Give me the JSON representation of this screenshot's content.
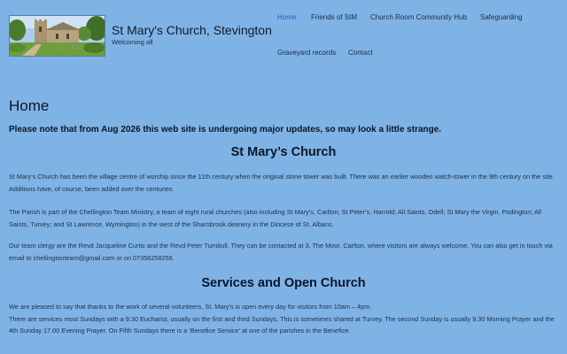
{
  "header": {
    "site_title": "St Mary's Church, Stevington",
    "tagline": "Welcoming all"
  },
  "nav": {
    "home": "Home",
    "friends": "Friends of StM",
    "hub": "Church Room Community Hub",
    "safeguarding": "Safeguarding",
    "graveyard": "Graveyard records",
    "contact": "Contact"
  },
  "main": {
    "page_heading": "Home",
    "notice": "Please note that from Aug 2026 this web site is undergoing major updates, so may look a little strange.",
    "section1_heading": "St Mary’s Church",
    "para1": "St Mary’s Church has been the village centre of worship since the 11th century when the original stone tower was built.  There was an earlier wooden watch-tower in the 9th century on the site.  Additions have, of course, been added over the centuries.",
    "para2": "The Parish is part of the Chellington Team Ministry, a team of eight rural churches (also including St Mary’s, Carlton; St Peter’s, Harrold; All Saints, Odell; St Mary the Virgin, Podington; All Saints, Turvey; and St Lawrence, Wymington) in the west of the Sharnbrook deanery in the Diocese of St. Albans.",
    "para3": "Our team clergy are the Revd Jacqueline Curtis and the Revd Peter Turnbull. They can be contacted at 3, The Moor, Carlton, where visitors are always welcome. You can also get in touch via email to chellingtonteam@gmail.com or on 07356258256.",
    "section2_heading": "Services and Open Church",
    "para4_line1": "We are pleased to say that thanks to the work of several volunteers, St. Mary’s is open every day for visitors from 10am – 4pm.",
    "para4_line2": "There are services most Sundays with a 9:30 Eucharist, usually on the first and third Sundays. This is sometimes shared at Turvey. The second Sunday is usually 9.30 Morning Prayer and the 4th Sunday 17.00 Evening Prayer. On Fifth Sundays there is a ‘Benefice Service’ at one of the parishes in the Benefice."
  },
  "colors": {
    "background": "#7fb3e6",
    "active_nav": "#1f5fd0"
  }
}
